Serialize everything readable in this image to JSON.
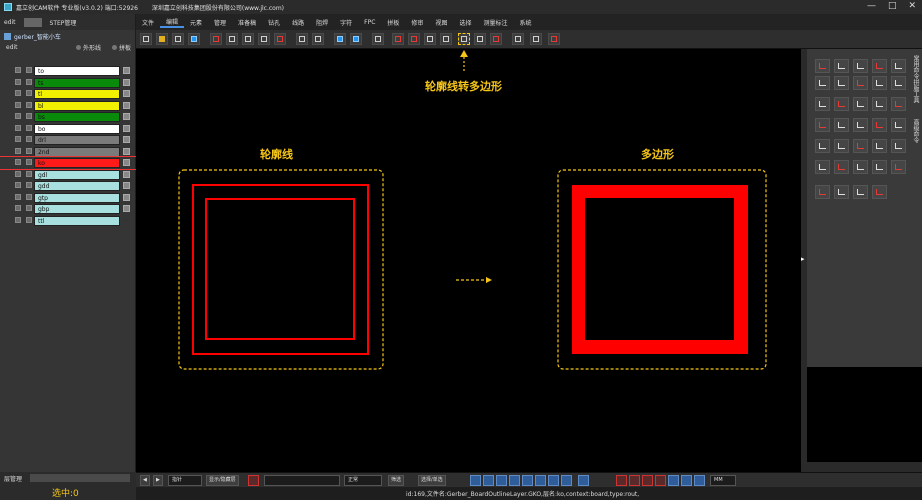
{
  "window": {
    "app_title": "嘉立创CAM软件 专业版(v3.0.2) 端口:52926",
    "company": "深圳嘉立创科技集团股份有限公司(www.jlc.com)",
    "controls": [
      "—",
      "□",
      "✕"
    ]
  },
  "menu": [
    "文件",
    "编辑",
    "元素",
    "管理",
    "准备稿",
    "钻孔",
    "线路",
    "阻焊",
    "字符",
    "FPC",
    "拼板",
    "修审",
    "视图",
    "选择",
    "测量标注",
    "系统"
  ],
  "left_panel": {
    "tab_edit": "edit",
    "tab_step": "STEP管理",
    "tree_root": "gerber_智能小车",
    "edit_label": "edit",
    "outline_option": "外形线",
    "panel_option": "拼板",
    "layers": [
      {
        "name": "to",
        "color": "#ffffff"
      },
      {
        "name": "ts",
        "color": "#0a8a0a"
      },
      {
        "name": "tl",
        "color": "#f0f000"
      },
      {
        "name": "bl",
        "color": "#f0f000"
      },
      {
        "name": "bs",
        "color": "#0a8a0a"
      },
      {
        "name": "bo",
        "color": "#ffffff"
      },
      {
        "name": "drl",
        "color": "#7a7a7a"
      },
      {
        "name": "2nd",
        "color": "#7a7a7a"
      },
      {
        "name": "ko",
        "color": "#ff1a1a"
      },
      {
        "name": "gdl",
        "color": "#a8e0e0"
      },
      {
        "name": "gdd",
        "color": "#a8e0e0"
      },
      {
        "name": "gtp",
        "color": "#a8e0e0"
      },
      {
        "name": "gbp",
        "color": "#a8e0e0"
      },
      {
        "name": "ttl",
        "color": "#a8e0e0"
      }
    ],
    "layer_manager": "层管理",
    "selected_count": "选中:0"
  },
  "canvas": {
    "annotation_top": "轮廓线转多边形",
    "label_left": "轮廓线",
    "label_right": "多边形"
  },
  "bottom_bar": {
    "mode_select": "指针",
    "show_hide": "显示/隐藏层",
    "display_mode": "正常",
    "filter_label": "筛选",
    "select_filter": "选择/单选",
    "unit": "MM"
  },
  "status": "id:169,文件名:Gerber_BoardOutlineLayer.GKO,层名:ko,context:board,type:rout,",
  "right_panel": {
    "side_labels": [
      "常用命令",
      "拼版工具",
      "高级命令"
    ]
  },
  "colors": {
    "accent_yellow": "#f5c518",
    "outline_red": "#ff0000"
  }
}
